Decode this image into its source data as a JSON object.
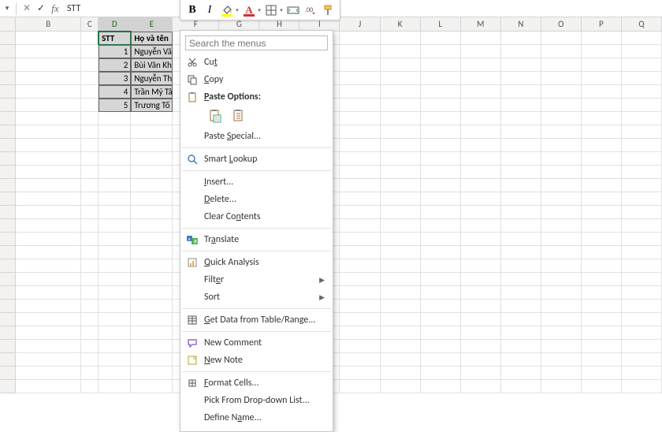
{
  "formulaBar": {
    "value": "STT"
  },
  "miniToolbar": {
    "bold": "B",
    "italic": "I"
  },
  "columns": [
    "B",
    "C",
    "D",
    "E",
    "F",
    "G",
    "H",
    "I",
    "J",
    "K",
    "L",
    "M",
    "N",
    "O",
    "P",
    "Q"
  ],
  "selectedCols": [
    "D",
    "E"
  ],
  "table": {
    "headers": {
      "stt": "STT",
      "name": "Họ và tên"
    },
    "rows": [
      {
        "idx": "1",
        "name": "Nguyễn Văn"
      },
      {
        "idx": "2",
        "name": "Bùi Văn Khi"
      },
      {
        "idx": "3",
        "name": "Nguyễn Tha"
      },
      {
        "idx": "4",
        "name": "Trần Mỹ Tâ"
      },
      {
        "idx": "5",
        "name": "Trương Tố"
      }
    ]
  },
  "menu": {
    "searchPlaceholder": "Search the menus",
    "cut": "Cut",
    "copy": "Copy",
    "pasteOptions": "Paste Options:",
    "pasteSpecial": "Paste Special...",
    "smartLookup": "Smart Lookup",
    "insert": "Insert...",
    "delete": "Delete...",
    "clearContents": "Clear Contents",
    "translate": "Translate",
    "quickAnalysis": "Quick Analysis",
    "filter": "Filter",
    "sort": "Sort",
    "getData": "Get Data from Table/Range...",
    "newComment": "New Comment",
    "newNote": "New Note",
    "formatCells": "Format Cells...",
    "pickList": "Pick From Drop-down List...",
    "defineName": "Define Name..."
  },
  "accel": {
    "cut": "t",
    "copy": "C",
    "pasteOptions": "P",
    "pasteSpecial": "S",
    "smartLookup": "L",
    "insert": "I",
    "delete": "D",
    "clearContents": "n",
    "translate": "a",
    "quickAnalysis": "Q",
    "filter": "e",
    "sort": "O",
    "getData": "G",
    "newComment": "M",
    "newNote": "N",
    "formatCells": "F",
    "pickList": "K",
    "defineName": "a"
  }
}
